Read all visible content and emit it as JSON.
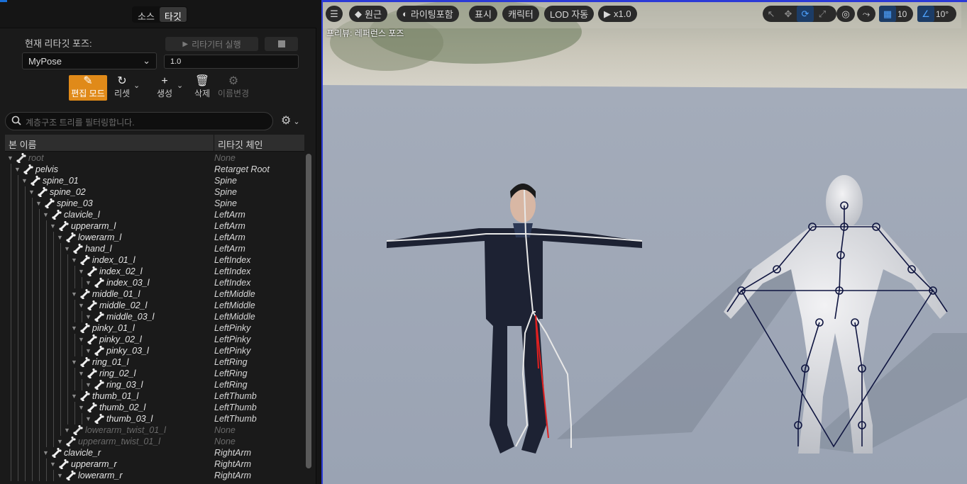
{
  "tabs": {
    "source": "소스",
    "target": "타깃"
  },
  "pose_panel": {
    "current_pose_label": "현재 리타깃 포즈:",
    "run_retargeter": "리타기터 실행",
    "pose_value": "MyPose",
    "number_value": "1.0"
  },
  "toolbar": {
    "edit_mode": "편집 모드",
    "reset": "리셋",
    "create": "생성",
    "delete": "삭제",
    "rename": "이름변경"
  },
  "search": {
    "placeholder": "계층구조 트리를 필터링합니다."
  },
  "tree": {
    "col_bone": "본 이름",
    "col_chain": "리타깃 체인",
    "rows": [
      {
        "name": "root",
        "chain": "None",
        "depth": 0,
        "dim": true
      },
      {
        "name": "pelvis",
        "chain": "Retarget Root",
        "depth": 1
      },
      {
        "name": "spine_01",
        "chain": "Spine",
        "depth": 2
      },
      {
        "name": "spine_02",
        "chain": "Spine",
        "depth": 3
      },
      {
        "name": "spine_03",
        "chain": "Spine",
        "depth": 4
      },
      {
        "name": "clavicle_l",
        "chain": "LeftArm",
        "depth": 5
      },
      {
        "name": "upperarm_l",
        "chain": "LeftArm",
        "depth": 6
      },
      {
        "name": "lowerarm_l",
        "chain": "LeftArm",
        "depth": 7
      },
      {
        "name": "hand_l",
        "chain": "LeftArm",
        "depth": 8
      },
      {
        "name": "index_01_l",
        "chain": "LeftIndex",
        "depth": 9
      },
      {
        "name": "index_02_l",
        "chain": "LeftIndex",
        "depth": 10
      },
      {
        "name": "index_03_l",
        "chain": "LeftIndex",
        "depth": 11
      },
      {
        "name": "middle_01_l",
        "chain": "LeftMiddle",
        "depth": 9
      },
      {
        "name": "middle_02_l",
        "chain": "LeftMiddle",
        "depth": 10
      },
      {
        "name": "middle_03_l",
        "chain": "LeftMiddle",
        "depth": 11
      },
      {
        "name": "pinky_01_l",
        "chain": "LeftPinky",
        "depth": 9
      },
      {
        "name": "pinky_02_l",
        "chain": "LeftPinky",
        "depth": 10
      },
      {
        "name": "pinky_03_l",
        "chain": "LeftPinky",
        "depth": 11
      },
      {
        "name": "ring_01_l",
        "chain": "LeftRing",
        "depth": 9
      },
      {
        "name": "ring_02_l",
        "chain": "LeftRing",
        "depth": 10
      },
      {
        "name": "ring_03_l",
        "chain": "LeftRing",
        "depth": 11
      },
      {
        "name": "thumb_01_l",
        "chain": "LeftThumb",
        "depth": 9
      },
      {
        "name": "thumb_02_l",
        "chain": "LeftThumb",
        "depth": 10
      },
      {
        "name": "thumb_03_l",
        "chain": "LeftThumb",
        "depth": 11
      },
      {
        "name": "lowerarm_twist_01_l",
        "chain": "None",
        "depth": 8,
        "dim": true
      },
      {
        "name": "upperarm_twist_01_l",
        "chain": "None",
        "depth": 7,
        "dim": true
      },
      {
        "name": "clavicle_r",
        "chain": "RightArm",
        "depth": 5
      },
      {
        "name": "upperarm_r",
        "chain": "RightArm",
        "depth": 6
      },
      {
        "name": "lowerarm_r",
        "chain": "RightArm",
        "depth": 7
      }
    ]
  },
  "viewport": {
    "menu_icon": "hamburger-icon",
    "perspective": "원근",
    "lighting": "라이팅포함",
    "show": "표시",
    "character": "캐릭터",
    "lod": "LOD 자동",
    "speed": "x1.0",
    "grid_value": "10",
    "angle_value": "10°",
    "preview_label": "프리뷰: 레퍼런스 포즈"
  }
}
